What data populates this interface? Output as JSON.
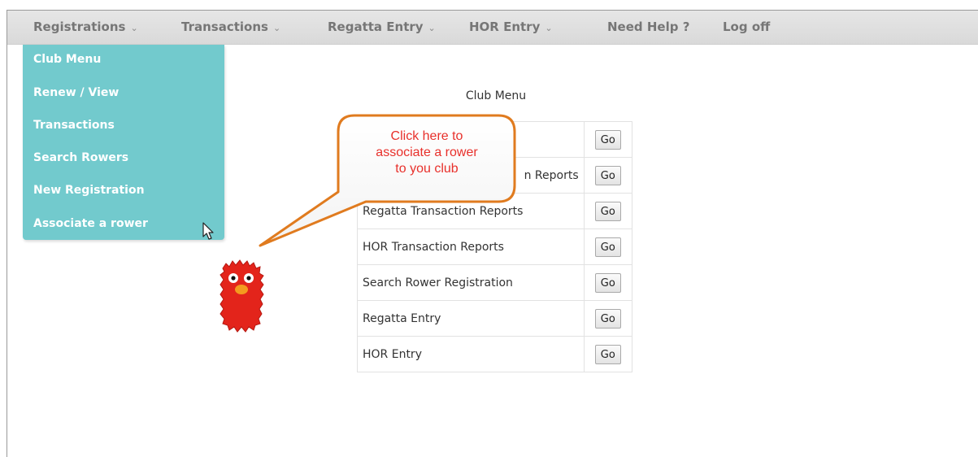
{
  "nav": {
    "items": [
      {
        "label": "Registrations",
        "chevron": "⌄"
      },
      {
        "label": "Transactions",
        "chevron": "⌄"
      },
      {
        "label": "Regatta Entry",
        "chevron": "⌄"
      },
      {
        "label": "HOR Entry",
        "chevron": "⌄"
      },
      {
        "label": "Need Help ?"
      },
      {
        "label": "Log off"
      }
    ]
  },
  "dropdown": {
    "items": [
      "Club Menu",
      "Renew / View",
      "Transactions",
      "Search Rowers",
      "New Registration",
      "Associate a rower"
    ]
  },
  "club_menu": {
    "title": "Club Menu",
    "go_label": "Go",
    "rows": [
      "",
      "n Reports",
      "Regatta Transaction Reports",
      "HOR Transaction Reports",
      "Search Rower Registration",
      "Regatta Entry",
      "HOR Entry"
    ]
  },
  "callout": {
    "lines": [
      "Click here to",
      "associate a rower",
      "to you club"
    ],
    "border_color": "#e07b1f",
    "text_color": "#e8302b"
  },
  "colors": {
    "dropdown_bg": "#72cacd",
    "nav_text": "#767676",
    "mascot": "#e3241b"
  }
}
